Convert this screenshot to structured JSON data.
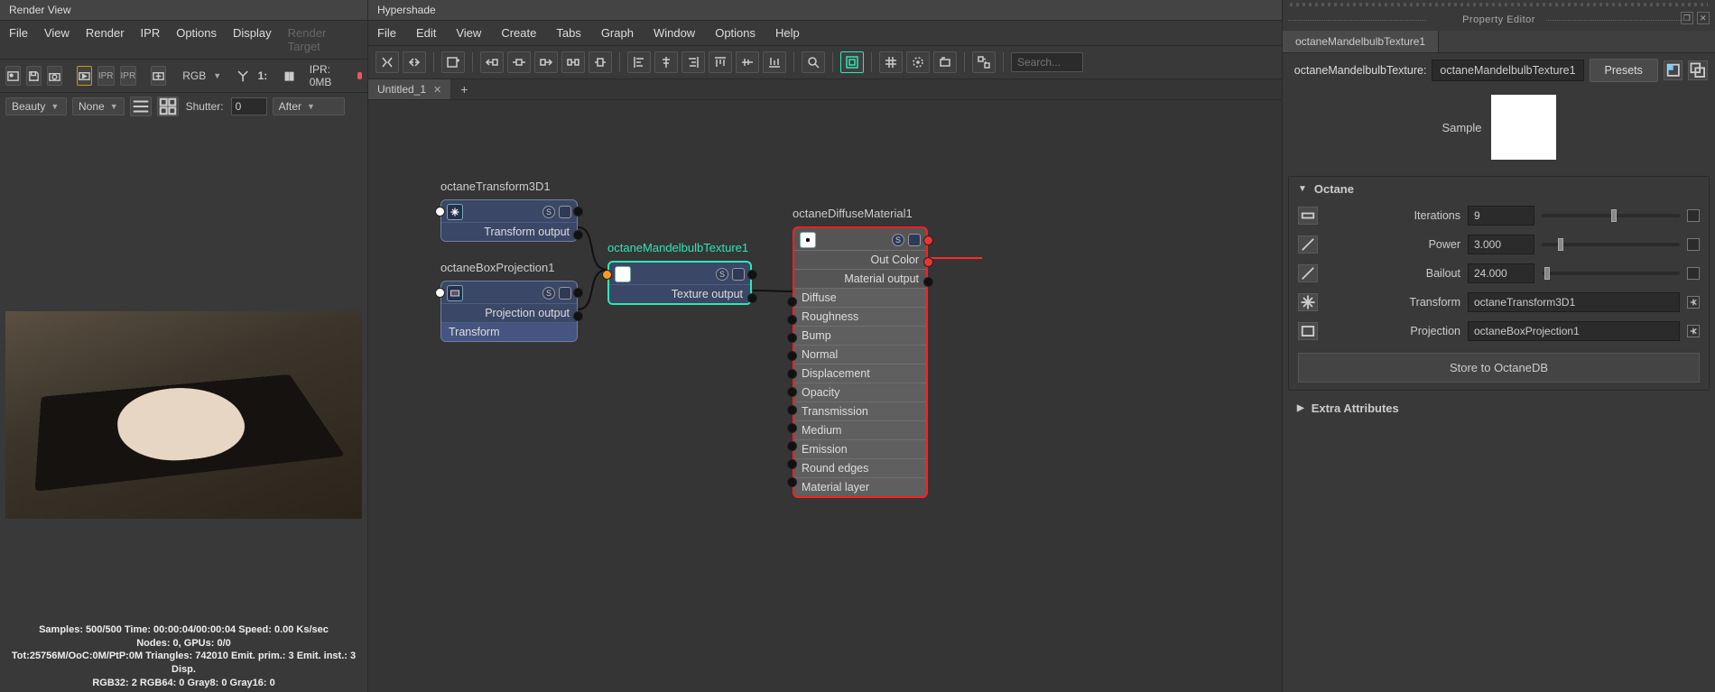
{
  "renderView": {
    "title": "Render View",
    "menu": [
      "File",
      "View",
      "Render",
      "IPR",
      "Options",
      "Display"
    ],
    "menuDisabled": "Render Target",
    "colorMode": "RGB",
    "ratio": "1:",
    "iprStatus": "IPR: 0MB",
    "passDropdown": "Beauty",
    "noneDropdown": "None",
    "shutterLabel": "Shutter:",
    "shutterValue": "0",
    "afterDropdown": "After",
    "stats": {
      "l1": "Samples: 500/500 Time: 00:00:04/00:00:04 Speed: 0.00 Ks/sec",
      "l2": "Nodes: 0, GPUs: 0/0",
      "l3": "Tot:25756M/OoC:0M/PtP:0M Triangles: 742010 Emit. prim.: 3 Emit. inst.: 3 Disp.",
      "l4": "RGB32: 2 RGB64: 0 Gray8: 0 Gray16: 0"
    }
  },
  "hypershade": {
    "title": "Hypershade",
    "menu": [
      "File",
      "Edit",
      "View",
      "Create",
      "Tabs",
      "Graph",
      "Window",
      "Options",
      "Help"
    ],
    "searchPlaceholder": "Search...",
    "tabName": "Untitled_1",
    "nodes": {
      "transform": {
        "title": "octaneTransform3D1",
        "out": "Transform output"
      },
      "boxproj": {
        "title": "octaneBoxProjection1",
        "out": "Projection output",
        "extra": "Transform"
      },
      "mandel": {
        "title": "octaneMandelbulbTexture1",
        "out": "Texture output"
      },
      "diffuse": {
        "title": "octaneDiffuseMaterial1",
        "outColor": "Out Color",
        "matOut": "Material output",
        "inputs": [
          "Diffuse",
          "Roughness",
          "Bump",
          "Normal",
          "Displacement",
          "Opacity",
          "Transmission",
          "Medium",
          "Emission",
          "Round edges",
          "Material layer"
        ]
      }
    }
  },
  "propertyEditor": {
    "header": "Property Editor",
    "tabLabel": "octaneMandelbulbTexture1",
    "typeLabel": "octaneMandelbulbTexture:",
    "nameValue": "octaneMandelbulbTexture1",
    "presets": "Presets",
    "sampleLabel": "Sample",
    "sections": {
      "octane": "Octane",
      "extra": "Extra Attributes"
    },
    "params": {
      "iterations": {
        "label": "Iterations",
        "value": "9"
      },
      "power": {
        "label": "Power",
        "value": "3.000"
      },
      "bailout": {
        "label": "Bailout",
        "value": "24.000"
      },
      "transform": {
        "label": "Transform",
        "value": "octaneTransform3D1"
      },
      "projection": {
        "label": "Projection",
        "value": "octaneBoxProjection1"
      }
    },
    "storeBtn": "Store to OctaneDB"
  }
}
